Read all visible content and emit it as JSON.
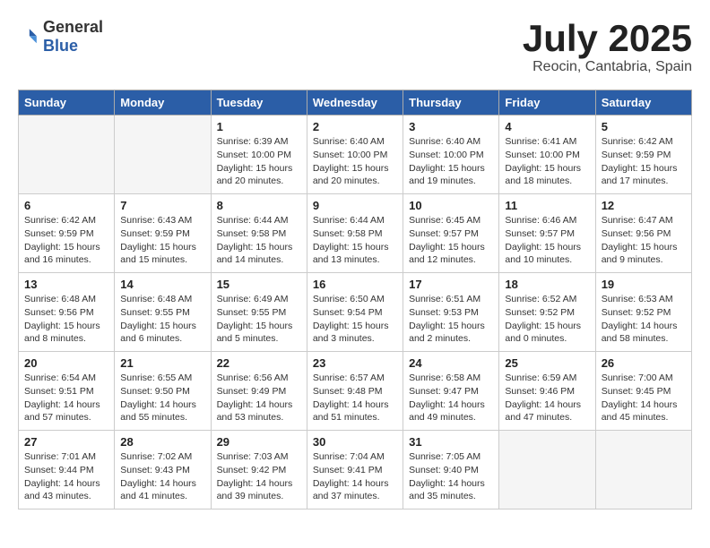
{
  "header": {
    "logo": {
      "text_general": "General",
      "text_blue": "Blue"
    },
    "title": "July 2025",
    "location": "Reocin, Cantabria, Spain"
  },
  "days_of_week": [
    "Sunday",
    "Monday",
    "Tuesday",
    "Wednesday",
    "Thursday",
    "Friday",
    "Saturday"
  ],
  "weeks": [
    [
      {
        "day": "",
        "empty": true
      },
      {
        "day": "",
        "empty": true
      },
      {
        "day": "1",
        "sunrise": "Sunrise: 6:39 AM",
        "sunset": "Sunset: 10:00 PM",
        "daylight": "Daylight: 15 hours and 20 minutes."
      },
      {
        "day": "2",
        "sunrise": "Sunrise: 6:40 AM",
        "sunset": "Sunset: 10:00 PM",
        "daylight": "Daylight: 15 hours and 20 minutes."
      },
      {
        "day": "3",
        "sunrise": "Sunrise: 6:40 AM",
        "sunset": "Sunset: 10:00 PM",
        "daylight": "Daylight: 15 hours and 19 minutes."
      },
      {
        "day": "4",
        "sunrise": "Sunrise: 6:41 AM",
        "sunset": "Sunset: 10:00 PM",
        "daylight": "Daylight: 15 hours and 18 minutes."
      },
      {
        "day": "5",
        "sunrise": "Sunrise: 6:42 AM",
        "sunset": "Sunset: 9:59 PM",
        "daylight": "Daylight: 15 hours and 17 minutes."
      }
    ],
    [
      {
        "day": "6",
        "sunrise": "Sunrise: 6:42 AM",
        "sunset": "Sunset: 9:59 PM",
        "daylight": "Daylight: 15 hours and 16 minutes."
      },
      {
        "day": "7",
        "sunrise": "Sunrise: 6:43 AM",
        "sunset": "Sunset: 9:59 PM",
        "daylight": "Daylight: 15 hours and 15 minutes."
      },
      {
        "day": "8",
        "sunrise": "Sunrise: 6:44 AM",
        "sunset": "Sunset: 9:58 PM",
        "daylight": "Daylight: 15 hours and 14 minutes."
      },
      {
        "day": "9",
        "sunrise": "Sunrise: 6:44 AM",
        "sunset": "Sunset: 9:58 PM",
        "daylight": "Daylight: 15 hours and 13 minutes."
      },
      {
        "day": "10",
        "sunrise": "Sunrise: 6:45 AM",
        "sunset": "Sunset: 9:57 PM",
        "daylight": "Daylight: 15 hours and 12 minutes."
      },
      {
        "day": "11",
        "sunrise": "Sunrise: 6:46 AM",
        "sunset": "Sunset: 9:57 PM",
        "daylight": "Daylight: 15 hours and 10 minutes."
      },
      {
        "day": "12",
        "sunrise": "Sunrise: 6:47 AM",
        "sunset": "Sunset: 9:56 PM",
        "daylight": "Daylight: 15 hours and 9 minutes."
      }
    ],
    [
      {
        "day": "13",
        "sunrise": "Sunrise: 6:48 AM",
        "sunset": "Sunset: 9:56 PM",
        "daylight": "Daylight: 15 hours and 8 minutes."
      },
      {
        "day": "14",
        "sunrise": "Sunrise: 6:48 AM",
        "sunset": "Sunset: 9:55 PM",
        "daylight": "Daylight: 15 hours and 6 minutes."
      },
      {
        "day": "15",
        "sunrise": "Sunrise: 6:49 AM",
        "sunset": "Sunset: 9:55 PM",
        "daylight": "Daylight: 15 hours and 5 minutes."
      },
      {
        "day": "16",
        "sunrise": "Sunrise: 6:50 AM",
        "sunset": "Sunset: 9:54 PM",
        "daylight": "Daylight: 15 hours and 3 minutes."
      },
      {
        "day": "17",
        "sunrise": "Sunrise: 6:51 AM",
        "sunset": "Sunset: 9:53 PM",
        "daylight": "Daylight: 15 hours and 2 minutes."
      },
      {
        "day": "18",
        "sunrise": "Sunrise: 6:52 AM",
        "sunset": "Sunset: 9:52 PM",
        "daylight": "Daylight: 15 hours and 0 minutes."
      },
      {
        "day": "19",
        "sunrise": "Sunrise: 6:53 AM",
        "sunset": "Sunset: 9:52 PM",
        "daylight": "Daylight: 14 hours and 58 minutes."
      }
    ],
    [
      {
        "day": "20",
        "sunrise": "Sunrise: 6:54 AM",
        "sunset": "Sunset: 9:51 PM",
        "daylight": "Daylight: 14 hours and 57 minutes."
      },
      {
        "day": "21",
        "sunrise": "Sunrise: 6:55 AM",
        "sunset": "Sunset: 9:50 PM",
        "daylight": "Daylight: 14 hours and 55 minutes."
      },
      {
        "day": "22",
        "sunrise": "Sunrise: 6:56 AM",
        "sunset": "Sunset: 9:49 PM",
        "daylight": "Daylight: 14 hours and 53 minutes."
      },
      {
        "day": "23",
        "sunrise": "Sunrise: 6:57 AM",
        "sunset": "Sunset: 9:48 PM",
        "daylight": "Daylight: 14 hours and 51 minutes."
      },
      {
        "day": "24",
        "sunrise": "Sunrise: 6:58 AM",
        "sunset": "Sunset: 9:47 PM",
        "daylight": "Daylight: 14 hours and 49 minutes."
      },
      {
        "day": "25",
        "sunrise": "Sunrise: 6:59 AM",
        "sunset": "Sunset: 9:46 PM",
        "daylight": "Daylight: 14 hours and 47 minutes."
      },
      {
        "day": "26",
        "sunrise": "Sunrise: 7:00 AM",
        "sunset": "Sunset: 9:45 PM",
        "daylight": "Daylight: 14 hours and 45 minutes."
      }
    ],
    [
      {
        "day": "27",
        "sunrise": "Sunrise: 7:01 AM",
        "sunset": "Sunset: 9:44 PM",
        "daylight": "Daylight: 14 hours and 43 minutes."
      },
      {
        "day": "28",
        "sunrise": "Sunrise: 7:02 AM",
        "sunset": "Sunset: 9:43 PM",
        "daylight": "Daylight: 14 hours and 41 minutes."
      },
      {
        "day": "29",
        "sunrise": "Sunrise: 7:03 AM",
        "sunset": "Sunset: 9:42 PM",
        "daylight": "Daylight: 14 hours and 39 minutes."
      },
      {
        "day": "30",
        "sunrise": "Sunrise: 7:04 AM",
        "sunset": "Sunset: 9:41 PM",
        "daylight": "Daylight: 14 hours and 37 minutes."
      },
      {
        "day": "31",
        "sunrise": "Sunrise: 7:05 AM",
        "sunset": "Sunset: 9:40 PM",
        "daylight": "Daylight: 14 hours and 35 minutes."
      },
      {
        "day": "",
        "empty": true
      },
      {
        "day": "",
        "empty": true
      }
    ]
  ]
}
